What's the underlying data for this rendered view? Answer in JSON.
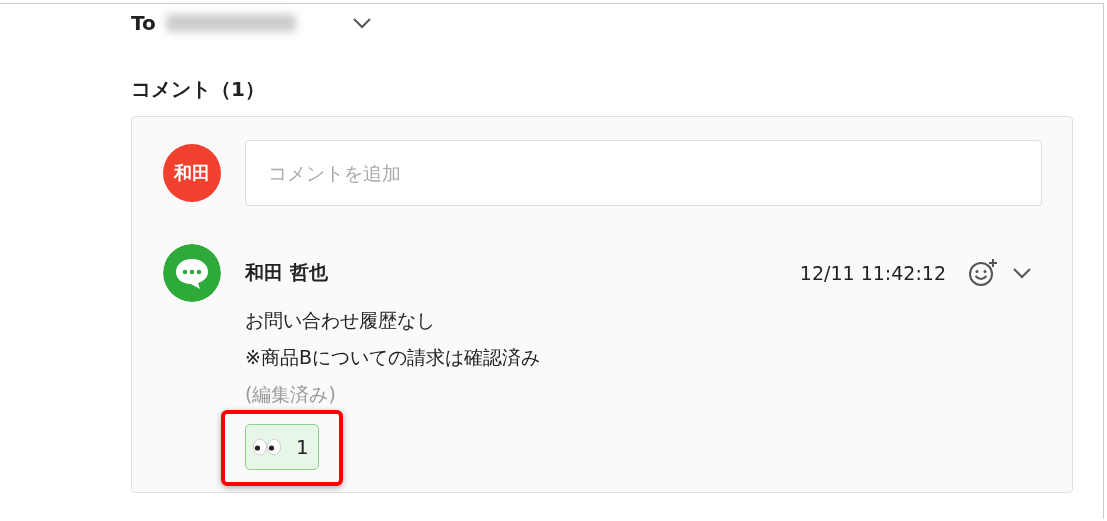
{
  "to": {
    "label": "To"
  },
  "comments_heading": "コメント（1）",
  "composer": {
    "avatar": "和田",
    "placeholder": "コメントを追加"
  },
  "comments": [
    {
      "author": "和田 哲也",
      "timestamp": "12/11 11:42:12",
      "lines": [
        "お問い合わせ履歴なし",
        "※商品Bについての請求は確認済み"
      ],
      "edited_note": "(編集済み)",
      "reactions": [
        {
          "count": "1",
          "highlighted": true
        }
      ]
    }
  ]
}
